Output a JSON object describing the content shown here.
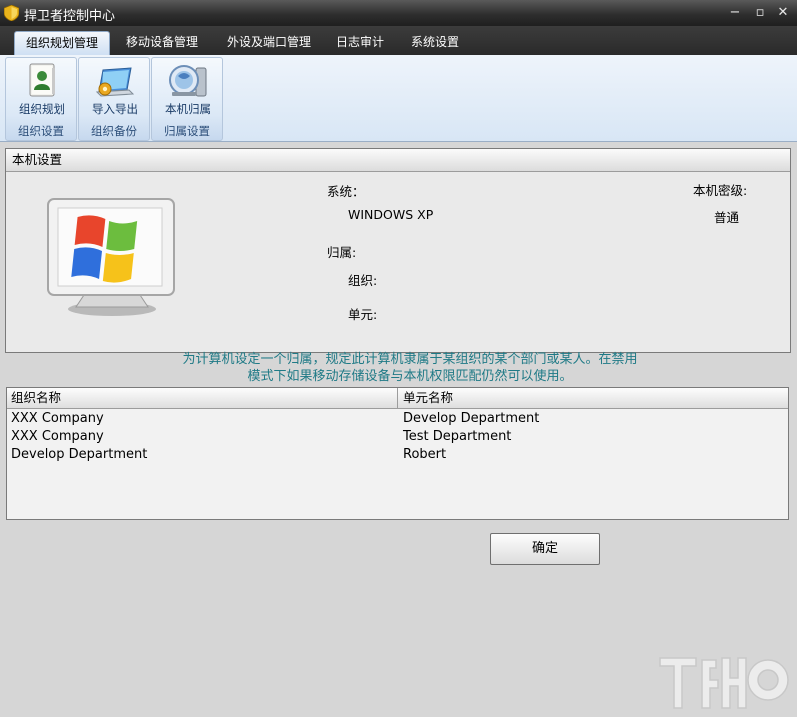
{
  "window": {
    "title": "捍卫者控制中心",
    "controls": [
      "−",
      "▫",
      "✕"
    ]
  },
  "tabs": [
    {
      "label": "组织规划管理",
      "active": true
    },
    {
      "label": "移动设备管理",
      "active": false
    },
    {
      "label": "外设及端口管理",
      "active": false
    },
    {
      "label": "日志审计",
      "active": false
    },
    {
      "label": "系统设置",
      "active": false
    }
  ],
  "ribbon": {
    "groups": [
      {
        "button": "组织规划",
        "group": "组织设置",
        "icon": "org-plan-icon"
      },
      {
        "button": "导入导出",
        "group": "组织备份",
        "icon": "import-export-icon"
      },
      {
        "button": "本机归属",
        "group": "归属设置",
        "icon": "local-belong-icon"
      }
    ]
  },
  "local_settings": {
    "header": "本机设置",
    "system_label": "系统：",
    "system_value": "WINDOWS XP",
    "security_label": "本机密级:",
    "security_value": "普通",
    "belong_label": "归属:",
    "org_label": "组织:",
    "unit_label": "单元:"
  },
  "hint": {
    "line1": "为计算机设定一个归属，规定此计算机隶属于某组织的某个部门或某人。在禁用",
    "line2": "模式下如果移动存储设备与本机权限匹配仍然可以使用。"
  },
  "table": {
    "columns": [
      "组织名称",
      "单元名称"
    ],
    "rows": [
      [
        "XXX Company",
        "Develop Department"
      ],
      [
        "XXX Company",
        "Test Department"
      ],
      [
        "Develop Department",
        "Robert"
      ]
    ]
  },
  "confirm_button": "确定",
  "colors": {
    "title_bar": "#2e2e2e",
    "ribbon": "#dbe8f6",
    "hint_text": "#1f7a86"
  }
}
